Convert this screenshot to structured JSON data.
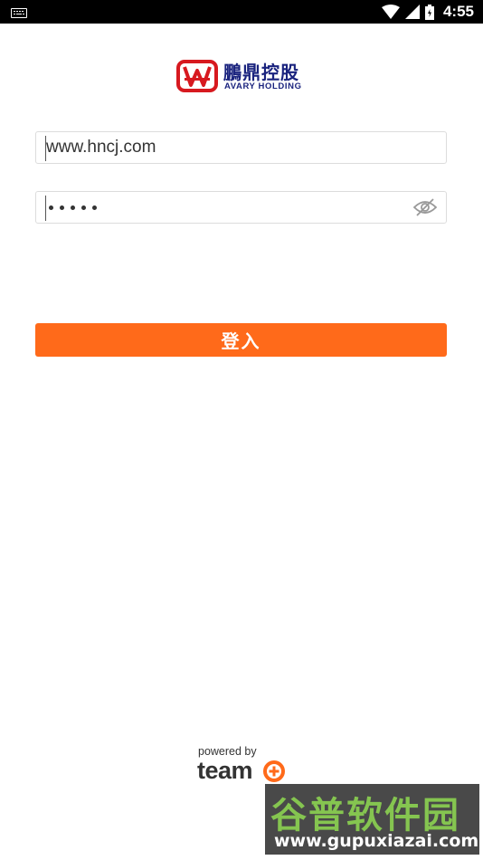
{
  "status_bar": {
    "time": "4:55",
    "icons": [
      "keyboard-icon",
      "wifi-icon",
      "signal-icon",
      "battery-icon"
    ]
  },
  "logo": {
    "chinese_name": "鵬鼎控股",
    "english_name": "AVARY HOLDING",
    "mark_color": "#d7191f",
    "text_color": "#1a237e"
  },
  "form": {
    "username_value": "www.hncj.com",
    "password_masked_length": 5,
    "password_toggle_icon": "eye-off-icon",
    "login_label": "登入",
    "accent_color": "#ff6a1a"
  },
  "footer": {
    "powered_by": "powered by",
    "brand": "team",
    "brand_icon": "plus-circle-icon"
  },
  "watermark": {
    "chinese": "谷普软件园",
    "url": "www.gupuxiazai.com"
  }
}
